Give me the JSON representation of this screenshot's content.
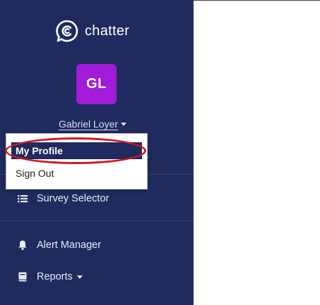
{
  "brand": {
    "name": "chatter",
    "logo_icon": "chat-bubble-c-icon"
  },
  "user": {
    "initials": "GL",
    "name": "Gabriel Loyer",
    "avatar_color": "#a21bd8"
  },
  "user_menu": {
    "items": [
      {
        "label": "My Profile",
        "active": true
      },
      {
        "label": "Sign Out",
        "active": false
      }
    ]
  },
  "nav": {
    "items": [
      {
        "label": "Survey Selector",
        "icon": "list-icon"
      },
      {
        "label": "Alert Manager",
        "icon": "bell-icon"
      },
      {
        "label": "Reports",
        "icon": "book-icon",
        "has_dropdown": true
      }
    ]
  },
  "colors": {
    "sidebar_bg": "#1f2b5e",
    "active_item_bg": "#1f2b5e",
    "annotation": "#d6161c"
  }
}
